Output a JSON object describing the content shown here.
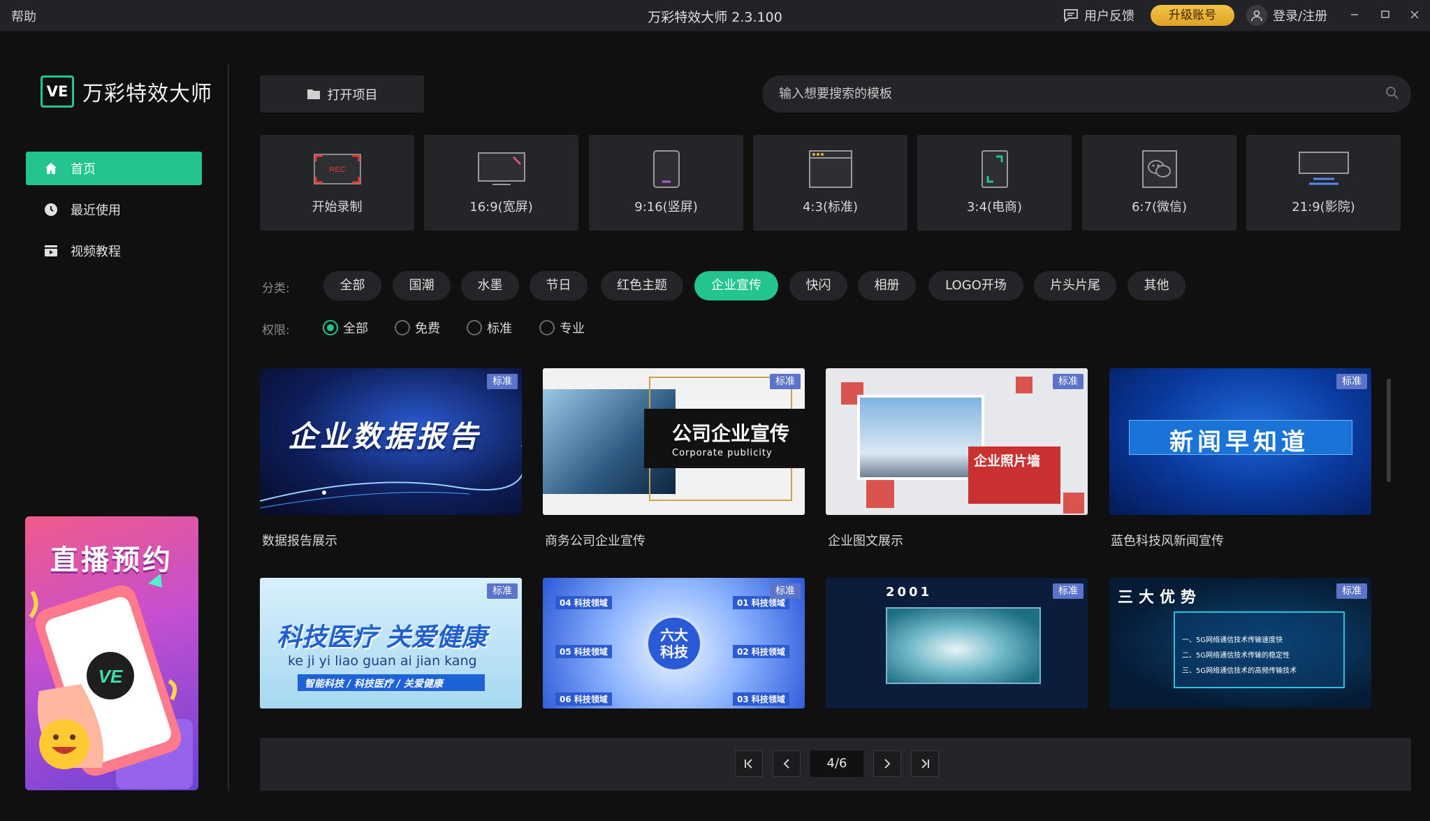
{
  "titlebar": {
    "help": "帮助",
    "title": "万彩特效大师 2.3.100",
    "feedback": "用户反馈",
    "upgrade": "升级账号",
    "login": "登录/注册"
  },
  "sidebar": {
    "logo_badge": "VE",
    "logo_text": "万彩特效大师",
    "nav": [
      {
        "label": "首页",
        "icon": "home-icon"
      },
      {
        "label": "最近使用",
        "icon": "clock-icon"
      },
      {
        "label": "视频教程",
        "icon": "video-tutorial-icon"
      }
    ],
    "promo_title": "直播预约",
    "promo_badge": "VE"
  },
  "toolbar": {
    "open_project": "打开项目",
    "search_placeholder": "输入想要搜索的模板"
  },
  "ratios": [
    {
      "label": "开始录制",
      "icon": "record-icon",
      "rec": "REC"
    },
    {
      "label": "16:9(宽屏)",
      "icon": "widescreen-icon"
    },
    {
      "label": "9:16(竖屏)",
      "icon": "portrait-phone-icon"
    },
    {
      "label": "4:3(标准)",
      "icon": "standard-window-icon"
    },
    {
      "label": "3:4(电商)",
      "icon": "ecommerce-icon"
    },
    {
      "label": "6:7(微信)",
      "icon": "wechat-icon"
    },
    {
      "label": "21:9(影院)",
      "icon": "cinema-icon"
    }
  ],
  "filters": {
    "category_label": "分类:",
    "categories": [
      "全部",
      "国潮",
      "水墨",
      "节日",
      "红色主题",
      "企业宣传",
      "快闪",
      "相册",
      "LOGO开场",
      "片头片尾",
      "其他"
    ],
    "active_category": "企业宣传",
    "permission_label": "权限:",
    "permissions": [
      "全部",
      "免费",
      "标准",
      "专业"
    ],
    "active_permission": "全部"
  },
  "templates": [
    {
      "name": "数据报告展示",
      "badge": "标准",
      "thumb_title": "企业数据报告"
    },
    {
      "name": "商务公司企业宣传",
      "badge": "标准",
      "thumb_title": "公司企业宣传",
      "thumb_sub": "Corporate publicity"
    },
    {
      "name": "企业图文展示",
      "badge": "标准",
      "thumb_title": "企业照片墙"
    },
    {
      "name": "蓝色科技风新闻宣传",
      "badge": "标准",
      "thumb_title": "新闻早知道"
    },
    {
      "name": "",
      "badge": "标准",
      "thumb_title": "科技医疗  关爱健康",
      "thumb_sub": "ke ji yi liao guan ai jian kang",
      "thumb_sub2": "智能科技 / 科技医疗 / 关爱健康"
    },
    {
      "name": "",
      "badge": "标准",
      "thumb_title": "六大科技",
      "items": [
        "04 科技领域",
        "05 科技领域",
        "06 科技领域",
        "01 科技领域",
        "02 科技领域",
        "03 科技领域"
      ]
    },
    {
      "name": "",
      "badge": "标准",
      "thumb_title": "2001"
    },
    {
      "name": "",
      "badge": "标准",
      "thumb_title": "三大优势",
      "items": [
        "一、5G网络通信技术传输速度快",
        "二、5G网络通信技术传输的稳定性",
        "三、5G网络通信技术的高频传输技术"
      ]
    }
  ],
  "pagination": {
    "current": "4/6"
  }
}
